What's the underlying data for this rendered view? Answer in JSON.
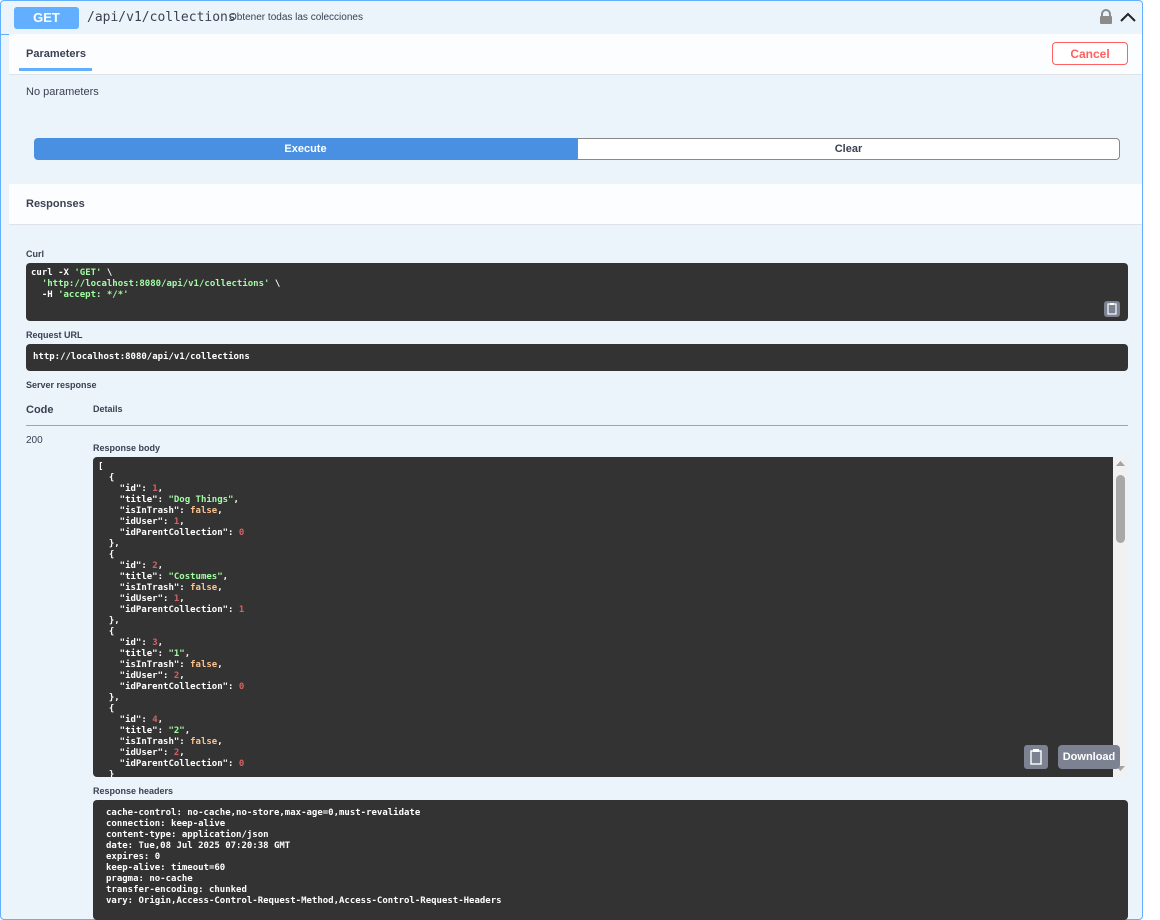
{
  "operation": {
    "method": "GET",
    "path": "/api/v1/collections",
    "description": "Obtener todas las colecciones"
  },
  "parameters": {
    "tab_label": "Parameters",
    "cancel_label": "Cancel",
    "empty_text": "No parameters"
  },
  "actions": {
    "execute_label": "Execute",
    "clear_label": "Clear"
  },
  "responses": {
    "title": "Responses",
    "curl_label": "Curl",
    "curl_lines": [
      "curl -X 'GET' \\",
      "  'http://localhost:8080/api/v1/collections' \\",
      "  -H 'accept: */*'"
    ],
    "request_url_label": "Request URL",
    "request_url": "http://localhost:8080/api/v1/collections",
    "server_response_label": "Server response",
    "code_header": "Code",
    "details_header": "Details",
    "code": "200",
    "response_body_label": "Response body",
    "response_body": [
      {
        "id": 1,
        "title": "Dog Things",
        "isInTrash": false,
        "idUser": 1,
        "idParentCollection": 0
      },
      {
        "id": 2,
        "title": "Costumes",
        "isInTrash": false,
        "idUser": 1,
        "idParentCollection": 1
      },
      {
        "id": 3,
        "title": "1",
        "isInTrash": false,
        "idUser": 2,
        "idParentCollection": 0
      },
      {
        "id": 4,
        "title": "2",
        "isInTrash": false,
        "idUser": 2,
        "idParentCollection": 0
      }
    ],
    "download_label": "Download",
    "response_headers_label": "Response headers",
    "response_headers": [
      "cache-control: no-cache,no-store,max-age=0,must-revalidate",
      "connection: keep-alive",
      "content-type: application/json",
      "date: Tue,08 Jul 2025 07:20:38 GMT",
      "expires: 0",
      "keep-alive: timeout=60",
      "pragma: no-cache",
      "transfer-encoding: chunked",
      "vary: Origin,Access-Control-Request-Method,Access-Control-Request-Headers"
    ]
  },
  "colors": {
    "accent": "#61affe",
    "execute": "#4990e2",
    "cancel": "#ff6060",
    "code_bg": "#333333"
  }
}
